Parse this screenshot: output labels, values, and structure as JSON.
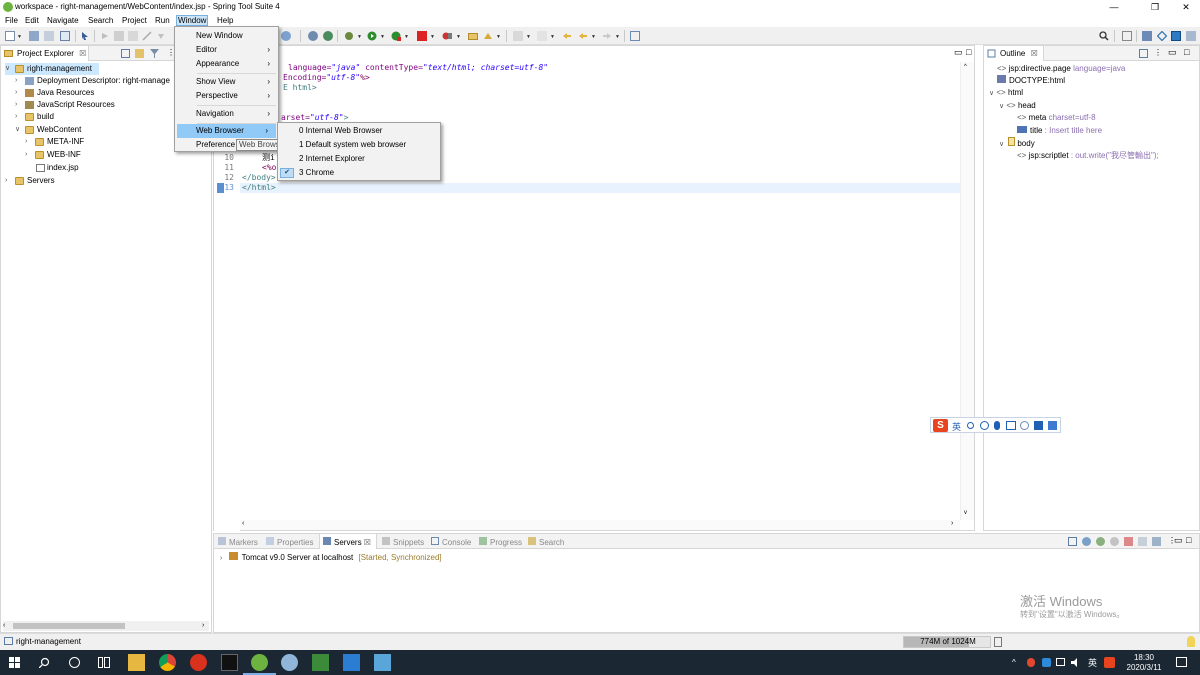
{
  "window": {
    "title": "workspace - right-management/WebContent/index.jsp - Spring Tool Suite 4",
    "min_glyph": "—",
    "max_glyph": "❐",
    "close_glyph": "✕"
  },
  "menubar": [
    "File",
    "Edit",
    "Navigate",
    "Search",
    "Project",
    "Run",
    "Window",
    "Help"
  ],
  "active_menu": "Window",
  "window_menu": {
    "items": [
      {
        "label": "New Window",
        "arrow": ""
      },
      {
        "label": "Editor",
        "arrow": "›"
      },
      {
        "label": "Appearance",
        "arrow": "›"
      },
      {
        "label": "Show View",
        "arrow": "›"
      },
      {
        "label": "Perspective",
        "arrow": "›"
      },
      {
        "label": "Navigation",
        "arrow": "›"
      },
      {
        "label": "Web Browser",
        "arrow": "›"
      },
      {
        "label": "Preference",
        "arrow": ""
      }
    ],
    "tooltip": "Web Browser"
  },
  "browser_submenu": {
    "items": [
      {
        "label": "0 Internal Web Browser",
        "checked": false
      },
      {
        "label": "1 Default system web browser",
        "checked": false
      },
      {
        "label": "2 Internet Explorer",
        "checked": false
      },
      {
        "label": "3 Chrome",
        "checked": true
      }
    ],
    "check_glyph": "✔"
  },
  "project_explorer": {
    "tab": "Project Explorer",
    "close": "☒",
    "items": [
      {
        "label": "right-management",
        "twisty": "∨"
      },
      {
        "label": "Deployment Descriptor: right-manage",
        "twisty": "›"
      },
      {
        "label": "Java Resources",
        "twisty": "›"
      },
      {
        "label": "JavaScript Resources",
        "twisty": "›"
      },
      {
        "label": "build",
        "twisty": "›"
      },
      {
        "label": "WebContent",
        "twisty": "∨"
      },
      {
        "label": "META-INF",
        "twisty": "›"
      },
      {
        "label": "WEB-INF",
        "twisty": "›"
      },
      {
        "label": "index.jsp",
        "twisty": ""
      },
      {
        "label": "Servers",
        "twisty": "›"
      }
    ]
  },
  "editor": {
    "lines": {
      "l1_a": "language=",
      "l1_b": "\"java\"",
      "l1_c": " contentType=",
      "l1_d": "\"text/html; charset=utf-8\"",
      "l2_a": "Encoding=",
      "l2_b": "\"utf-8\"",
      "l2_c": "%>",
      "l3": "E html>",
      "l4_a": "arset=",
      "l4_b": "\"utf-8\"",
      "l4_c": ">",
      "l10": "测i",
      "l11": "<%o",
      "l12": "</body>",
      "l13": "</html>"
    },
    "line_numbers": [
      "10",
      "11",
      "12",
      "13"
    ]
  },
  "outline": {
    "tab": "Outline",
    "close": "☒",
    "items": [
      {
        "label": "jsp:directive.page",
        "extra": " language=java",
        "prefix": "<>",
        "twisty": ""
      },
      {
        "label": "DOCTYPE:html",
        "extra": "",
        "prefix": "",
        "twisty": ""
      },
      {
        "label": "html",
        "extra": "",
        "prefix": "<>",
        "twisty": "∨"
      },
      {
        "label": "head",
        "extra": "",
        "prefix": "<>",
        "twisty": "∨"
      },
      {
        "label": "meta",
        "extra": " charset=utf-8",
        "prefix": "<>",
        "twisty": ""
      },
      {
        "label": "title",
        "extra": " : Insert title here",
        "prefix": "",
        "twisty": ""
      },
      {
        "label": "body",
        "extra": "",
        "prefix": "",
        "twisty": "∨"
      },
      {
        "label": "jsp:scriptlet",
        "extra": " : out.write(\"我尽管輸出\");",
        "prefix": "<>",
        "twisty": ""
      }
    ]
  },
  "bottom_panel": {
    "tabs": [
      "Markers",
      "Properties",
      "Servers",
      "Snippets",
      "Console",
      "Progress",
      "Search"
    ],
    "active_tab": "Servers",
    "server": "Tomcat v9.0 Server at localhost",
    "server_state": "[Started, Synchronized]"
  },
  "ime_toolbar": {
    "logo": "S",
    "lang": "英"
  },
  "watermark": {
    "line1": "激活 Windows",
    "line2": "转到\"设置\"以激活 Windows。"
  },
  "statusbar": {
    "project": "right-management",
    "memory": "774M of 1024M"
  },
  "taskbar": {
    "time": "18:30",
    "date": "2020/3/11",
    "ime": "英"
  },
  "colors": {
    "accent": "#91c9f7",
    "taskbar": "#1b2733",
    "keyword": "#7f0055",
    "string": "#2a00ff",
    "tag": "#3f7f7f"
  }
}
